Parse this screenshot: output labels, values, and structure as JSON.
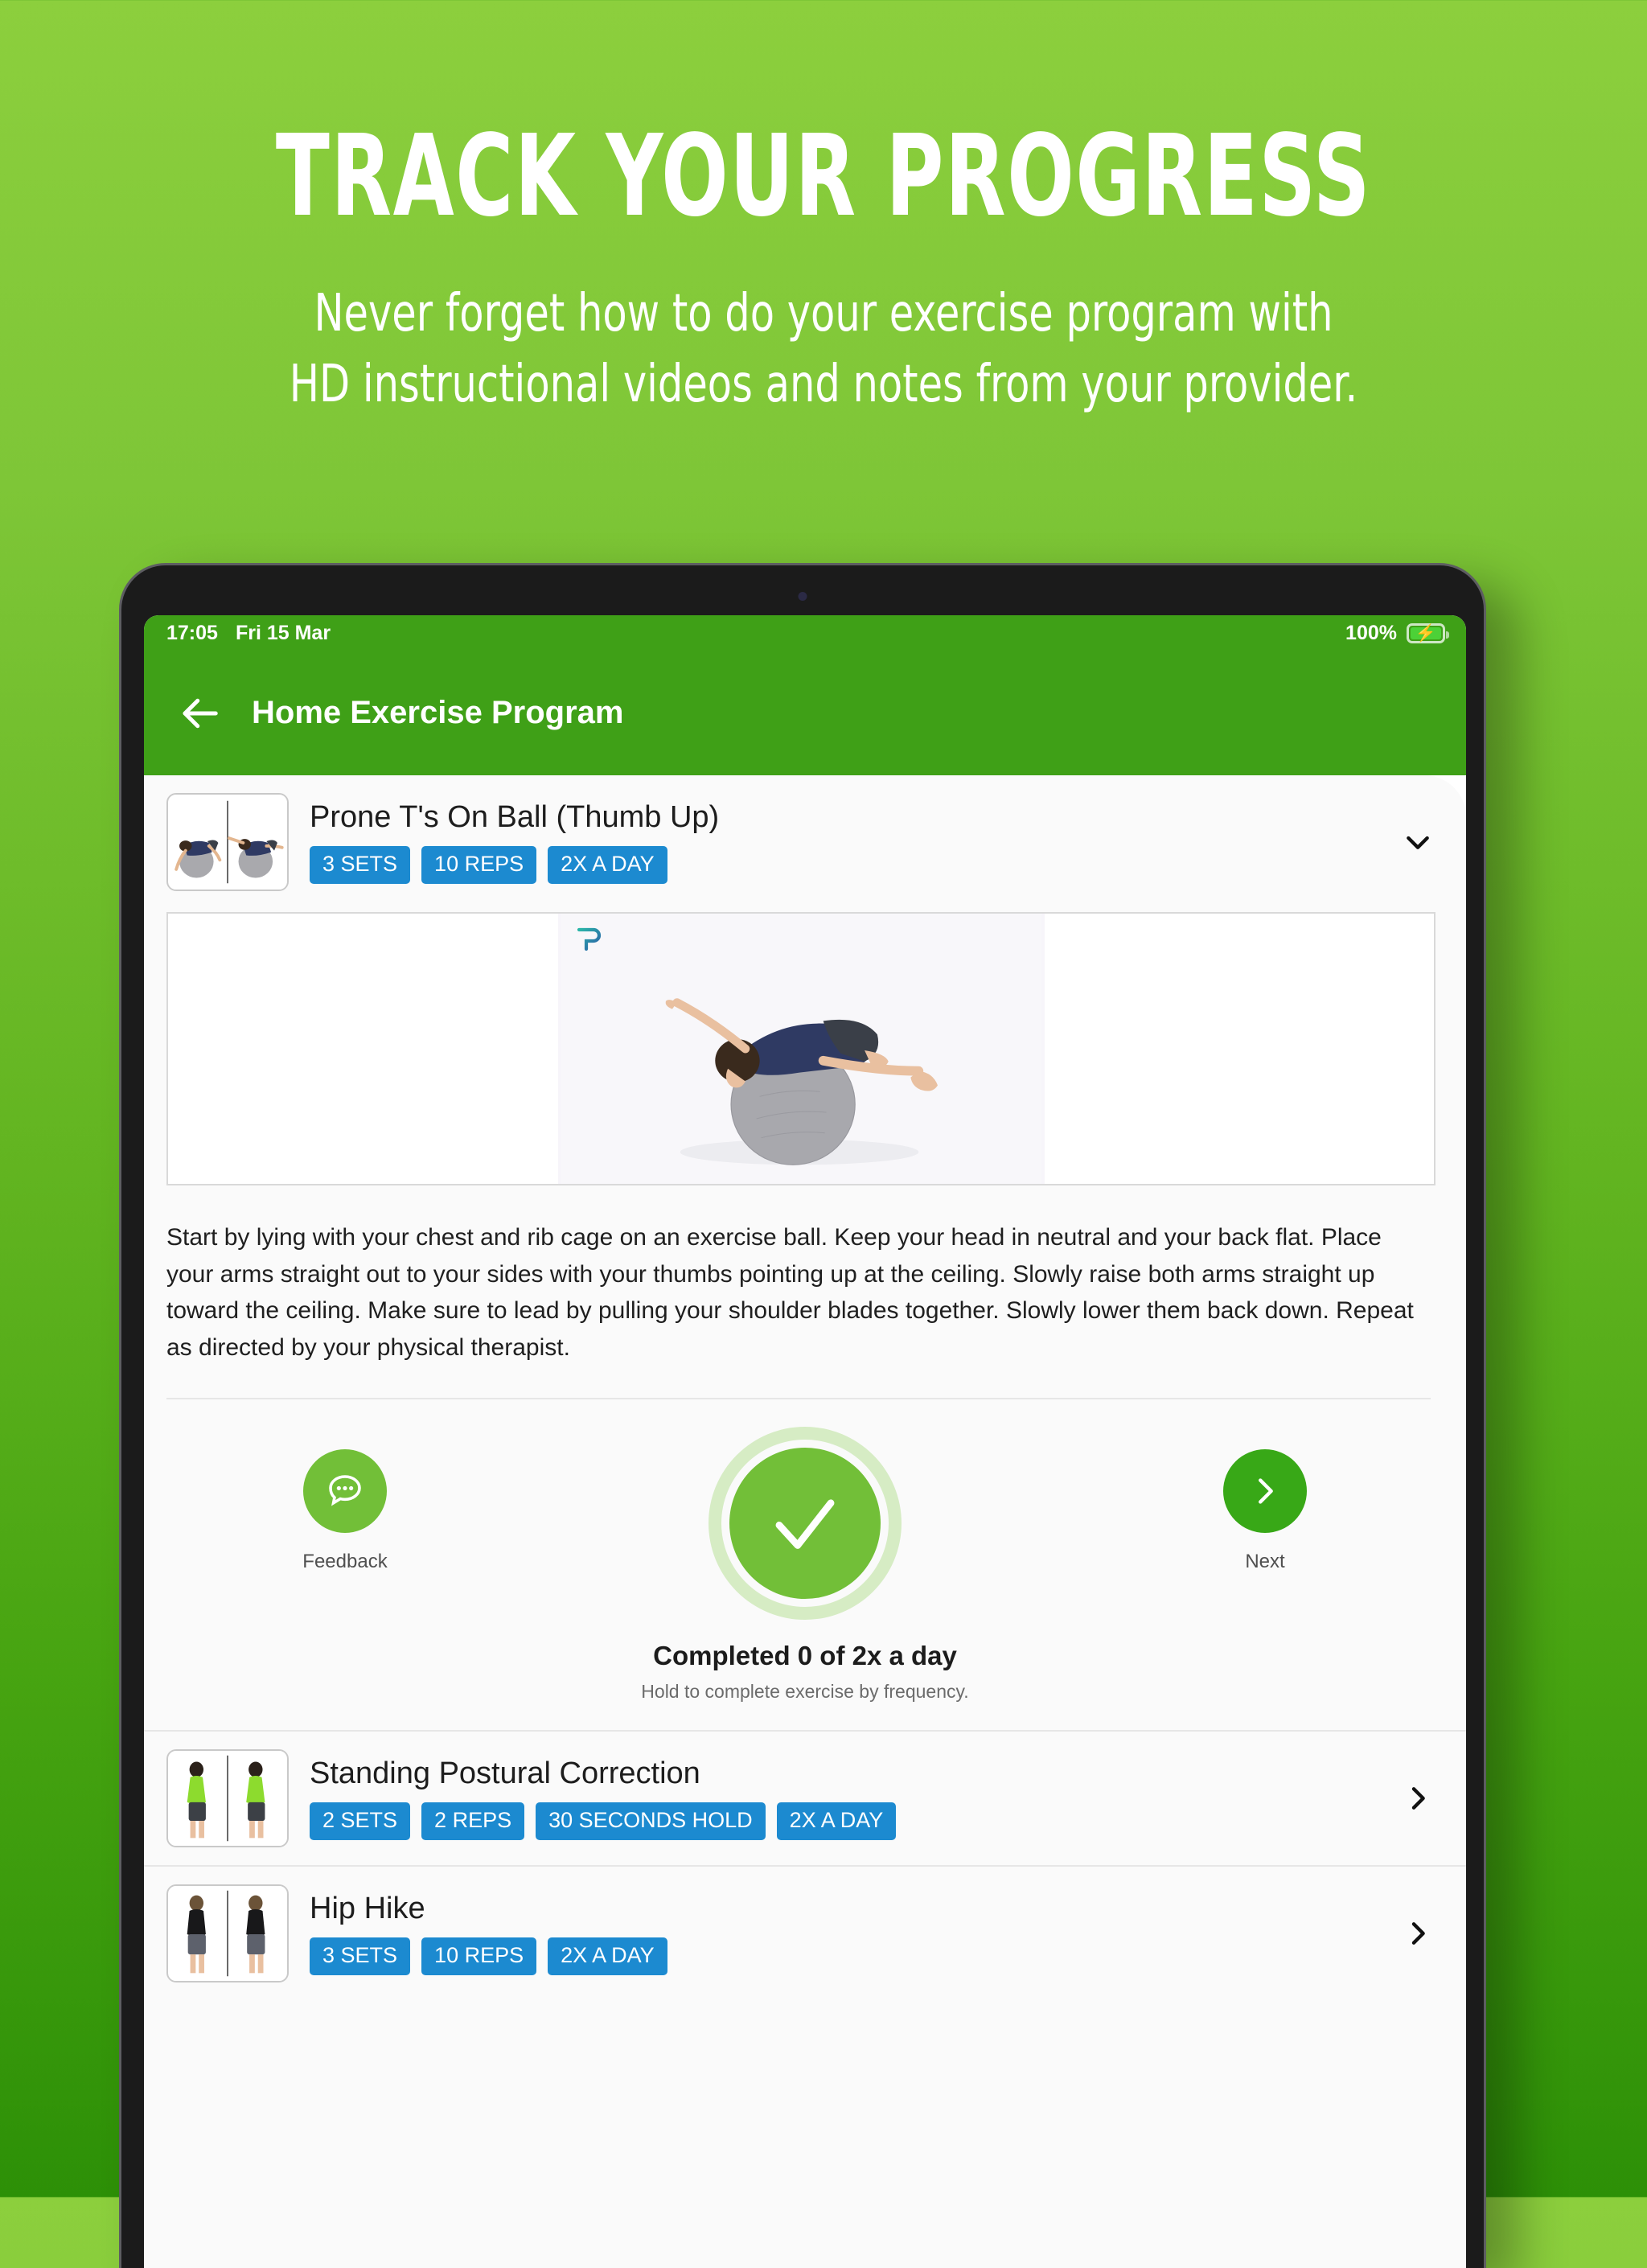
{
  "promo": {
    "title": "TRACK YOUR PROGRESS",
    "subtitle": "Never forget how to do your exercise program with\nHD instructional videos and notes from your provider."
  },
  "colors": {
    "brand_green": "#3fa017",
    "accent_green": "#72bf38",
    "badge_blue": "#1c8ad0",
    "bg_top": "#8ccf3d",
    "bg_bottom": "#2d9007"
  },
  "status_bar": {
    "time": "17:05",
    "date": "Fri 15 Mar",
    "battery_percent": "100%",
    "battery_icon": "battery-charging-icon"
  },
  "app_bar": {
    "back_icon": "arrow-left-icon",
    "title": "Home Exercise Program"
  },
  "active_exercise": {
    "title": "Prone T's On Ball (Thumb Up)",
    "thumbnail_icon": "exercise-thumbnail-prone-t",
    "expand_icon": "chevron-down-icon",
    "badges": [
      "3 SETS",
      "10 REPS",
      "2X A DAY"
    ],
    "video": {
      "logo_icon": "provider-logo-icon",
      "frame_icon": "video-frame-prone-t-on-ball"
    },
    "description": "Start by lying with your chest and rib cage on an exercise ball. Keep your head in neutral and your back flat. Place your arms straight out to your sides with your thumbs pointing up at the ceiling. Slowly raise both arms straight up toward the ceiling. Make sure to lead by pulling your shoulder blades together. Slowly lower them back down. Repeat as directed by your physical therapist.",
    "actions": {
      "feedback_label": "Feedback",
      "feedback_icon": "chat-bubble-icon",
      "complete_icon": "check-icon",
      "next_label": "Next",
      "next_icon": "chevron-right-icon"
    },
    "completion": {
      "title": "Completed 0 of 2x a day",
      "hint": "Hold to complete exercise by frequency."
    }
  },
  "other_exercises": [
    {
      "title": "Standing Postural Correction",
      "thumbnail_icon": "exercise-thumbnail-standing-postural",
      "badges": [
        "2 SETS",
        "2 REPS",
        "30 SECONDS HOLD",
        "2X A DAY"
      ],
      "chevron_icon": "chevron-right-icon"
    },
    {
      "title": "Hip Hike",
      "thumbnail_icon": "exercise-thumbnail-hip-hike",
      "badges": [
        "3 SETS",
        "10 REPS",
        "2X A DAY"
      ],
      "chevron_icon": "chevron-right-icon"
    }
  ]
}
